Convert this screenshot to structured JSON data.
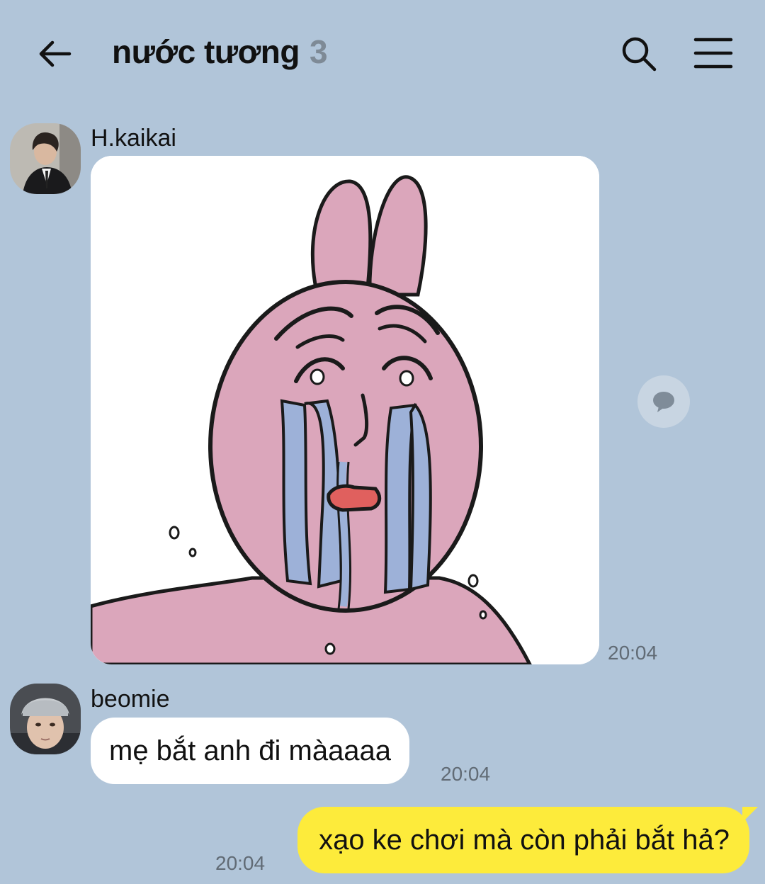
{
  "header": {
    "title": "nước tương",
    "member_count": "3"
  },
  "messages": [
    {
      "sender": "H.kaikai",
      "type": "image",
      "time": "20:04"
    },
    {
      "sender": "beomie",
      "type": "text",
      "text": "mẹ bắt anh đi màaaaa",
      "time": "20:04"
    },
    {
      "sender": "me",
      "type": "text",
      "text": "xạo ke chơi mà còn phải bắt hả?",
      "time": "20:04"
    }
  ],
  "colors": {
    "background": "#b1c5d9",
    "incoming_bubble": "#ffffff",
    "outgoing_bubble": "#fdeb3b",
    "timestamp": "#616b75",
    "member_count": "#7e8a96"
  }
}
